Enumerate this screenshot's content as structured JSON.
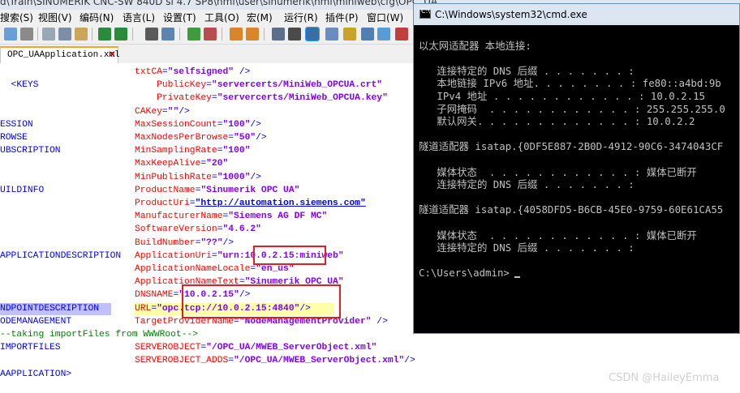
{
  "npp": {
    "title": "d\\Train\\SINUMERIK CNC-SW 840D sl 4.7 SP8\\hmi\\user\\sinumerik\\hmi\\miniweb\\cfg\\OPC_UA...",
    "menu": [
      "搜索(S)",
      "视图(V)",
      "编码(N)",
      "语言(L)",
      "设置(T)",
      "工具(O)",
      "宏(M)",
      "运行(R)",
      "插件(P)",
      "窗口(W)"
    ],
    "tab": {
      "label": "OPC_UAApplication.xml",
      "close": "✕"
    },
    "lines": [
      {
        "tag": "",
        "name": "txtCA",
        "value": "\"selfsigned\"",
        "tail": " />"
      },
      {
        "tag": "  <KEYS",
        "pad": "    ",
        "name": "PublicKey",
        "value": "\"servercerts/MiniWeb_OPCUA.crt\"",
        "tail": ""
      },
      {
        "tag": "",
        "pad": "    ",
        "name": "PrivateKey",
        "value": "\"servercerts/MiniWeb_OPCUA.key\"",
        "tail": ""
      },
      {
        "tag": "",
        "name": "CAKey",
        "value": "\"\"",
        "tail": "/>"
      },
      {
        "tag": "ESSION",
        "name": "MaxSessionCount",
        "value": "\"100\"",
        "tail": "/>"
      },
      {
        "tag": "ROWSE",
        "name": "MaxNodesPerBrowse",
        "value": "\"50\"",
        "tail": "/>"
      },
      {
        "tag": "UBSCRIPTION",
        "name": "MinSamplingRate",
        "value": "\"100\"",
        "tail": ""
      },
      {
        "tag": "",
        "name": "MaxKeepAlive",
        "value": "\"20\"",
        "tail": ""
      },
      {
        "tag": "",
        "name": "MinPublishRate",
        "value": "\"1000\"",
        "tail": "/>"
      },
      {
        "tag": "UILDINFO",
        "name": "ProductName",
        "value": "\"Sinumerik OPC UA\"",
        "tail": ""
      },
      {
        "tag": "",
        "name": "ProductUri",
        "value": "\"http://automation.siemens.com\"",
        "tail": ""
      },
      {
        "tag": "",
        "name": "ManufacturerName",
        "value": "\"Siemens AG DF MC\"",
        "tail": ""
      },
      {
        "tag": "",
        "name": "SoftwareVersion",
        "value": "\"4.6.2\"",
        "tail": ""
      },
      {
        "tag": "",
        "name": "BuildNumber",
        "value": "\"??\"",
        "tail": "/>"
      },
      {
        "tag": "APPLICATIONDESCRIPTION",
        "name": "ApplicationUri",
        "value": "\"urn:10.0.2.15:miniweb\"",
        "tail": ""
      },
      {
        "tag": "",
        "name": "ApplicationNameLocale",
        "value": "\"en_us\"",
        "tail": ""
      },
      {
        "tag": "",
        "name": "ApplicationNameText",
        "value": "\"Sinumerik OPC UA\"",
        "tail": ""
      },
      {
        "tag": "",
        "name": "DNSNAME",
        "value": "\"10.0.2.15\"",
        "tail": "/>"
      },
      {
        "tag": "NDPOINTDESCRIPTION",
        "name": "URL",
        "value": "\"opc.tcp://10.0.2.15:4840\"",
        "tail": "/>"
      },
      {
        "tag": "ODEMANAGEMENT",
        "name": "TargetProviderName",
        "value": "\"NodeManagementProvider\"",
        "tail": " />"
      },
      {
        "comment": "--taking importFiles from WWWRoot-->"
      },
      {
        "tag": "IMPORTFILES",
        "name": "SERVEROBJECT",
        "value": "\"/OPC_UA/MWEB_ServerObject.xml\"",
        "tail": ""
      },
      {
        "tag": "",
        "name": "SERVEROBJECT_ADDS",
        "value": "\"/OPC_UA/MWEB_ServerObject.xml\"",
        "tail": "/>"
      },
      {
        "tag": "AAPPLICATION>",
        "name": "",
        "value": "",
        "tail": ""
      }
    ]
  },
  "cmd": {
    "title": "C:\\Windows\\system32\\cmd.exe",
    "lines": [
      "",
      "以太网适配器 本地连接:",
      "",
      "   连接特定的 DNS 后缀 . . . . . . . :",
      "   本地链接 IPv6 地址. . . . . . . . : fe80::a4bd:9b",
      "   IPv4 地址 . . . . . . . . . . . . : 10.0.2.15",
      "   子网掩码  . . . . . . . . . . . . : 255.255.255.0",
      "   默认网关. . . . . . . . . . . . . : 10.0.2.2",
      "",
      "隧道适配器 isatap.{0DF5E887-2B0D-4912-90C6-3474043CF",
      "",
      "   媒体状态  . . . . . . . . . . . . : 媒体已断开",
      "   连接特定的 DNS 后缀 . . . . . . . :",
      "",
      "隧道适配器 isatap.{4058DFD5-B6CB-45E0-9759-60E61CA55",
      "",
      "   媒体状态  . . . . . . . . . . . . : 媒体已断开",
      "   连接特定的 DNS 后缀 . . . . . . . :",
      "",
      "C:\\Users\\admin>"
    ]
  },
  "watermark": "CSDN @HaileyEmma"
}
